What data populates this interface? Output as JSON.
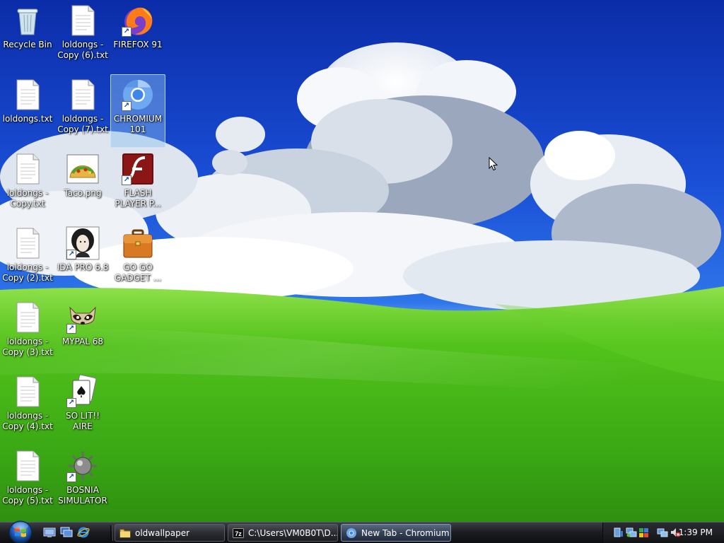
{
  "desktop": {
    "icons": [
      {
        "label": "Recycle Bin",
        "icon": "recycle-bin-icon"
      },
      {
        "label": "loldongs - Copy (6).txt",
        "icon": "text-file-icon"
      },
      {
        "label": "FIREFOX 91",
        "icon": "firefox-icon"
      },
      {
        "label": "loldongs.txt",
        "icon": "text-file-icon"
      },
      {
        "label": "loldongs - Copy (7).txt",
        "icon": "text-file-icon"
      },
      {
        "label": "CHROMIUM 101",
        "icon": "chromium-icon"
      },
      {
        "label": "loldongs - Copy.txt",
        "icon": "text-file-icon"
      },
      {
        "label": "Taco.png",
        "icon": "taco-image-icon"
      },
      {
        "label": "FLASH PLAYER P...",
        "icon": "flash-player-icon"
      },
      {
        "label": "loldongs - Copy (2).txt",
        "icon": "text-file-icon"
      },
      {
        "label": "IDA PRO 6.8",
        "icon": "ida-pro-icon"
      },
      {
        "label": "GO GO GADGET ...",
        "icon": "briefcase-icon"
      },
      {
        "label": "loldongs - Copy (3).txt",
        "icon": "text-file-icon"
      },
      {
        "label": "MYPAL 68",
        "icon": "mypal-raccoon-icon"
      },
      {
        "label": "loldongs - Copy (4).txt",
        "icon": "text-file-icon"
      },
      {
        "label": "SO LIT!! AIRE",
        "icon": "solitaire-cards-icon"
      },
      {
        "label": "loldongs - Copy (5).txt",
        "icon": "text-file-icon"
      },
      {
        "label": "BOSNIA SIMULATOR",
        "icon": "spiked-mine-icon"
      }
    ],
    "selected_icon": "CHROMIUM 101"
  },
  "taskbar": {
    "start_icon": "windows-orb-icon",
    "quicklaunch": [
      {
        "icon": "show-desktop-icon"
      },
      {
        "icon": "switch-windows-icon"
      },
      {
        "icon": "internet-explorer-icon"
      }
    ],
    "tasks": [
      {
        "label": "oldwallpaper",
        "icon": "folder-icon",
        "active": false
      },
      {
        "label": "C:\\Users\\VM0B0T\\D...",
        "icon": "7zip-icon",
        "active": false
      },
      {
        "label": "New Tab - Chromium",
        "icon": "chromium-icon",
        "active": true
      }
    ],
    "tray": {
      "icons": [
        "device-icon",
        "network-tray-icon",
        "windows-flag-tray-icon",
        "network-status-icon",
        "volume-muted-icon"
      ],
      "clock": "1:39 PM"
    }
  },
  "colors": {
    "sky_top": "#0b2ca8",
    "grass": "#4fc21a",
    "taskbar": "#1c1e22",
    "selection": "#8cbef0"
  }
}
